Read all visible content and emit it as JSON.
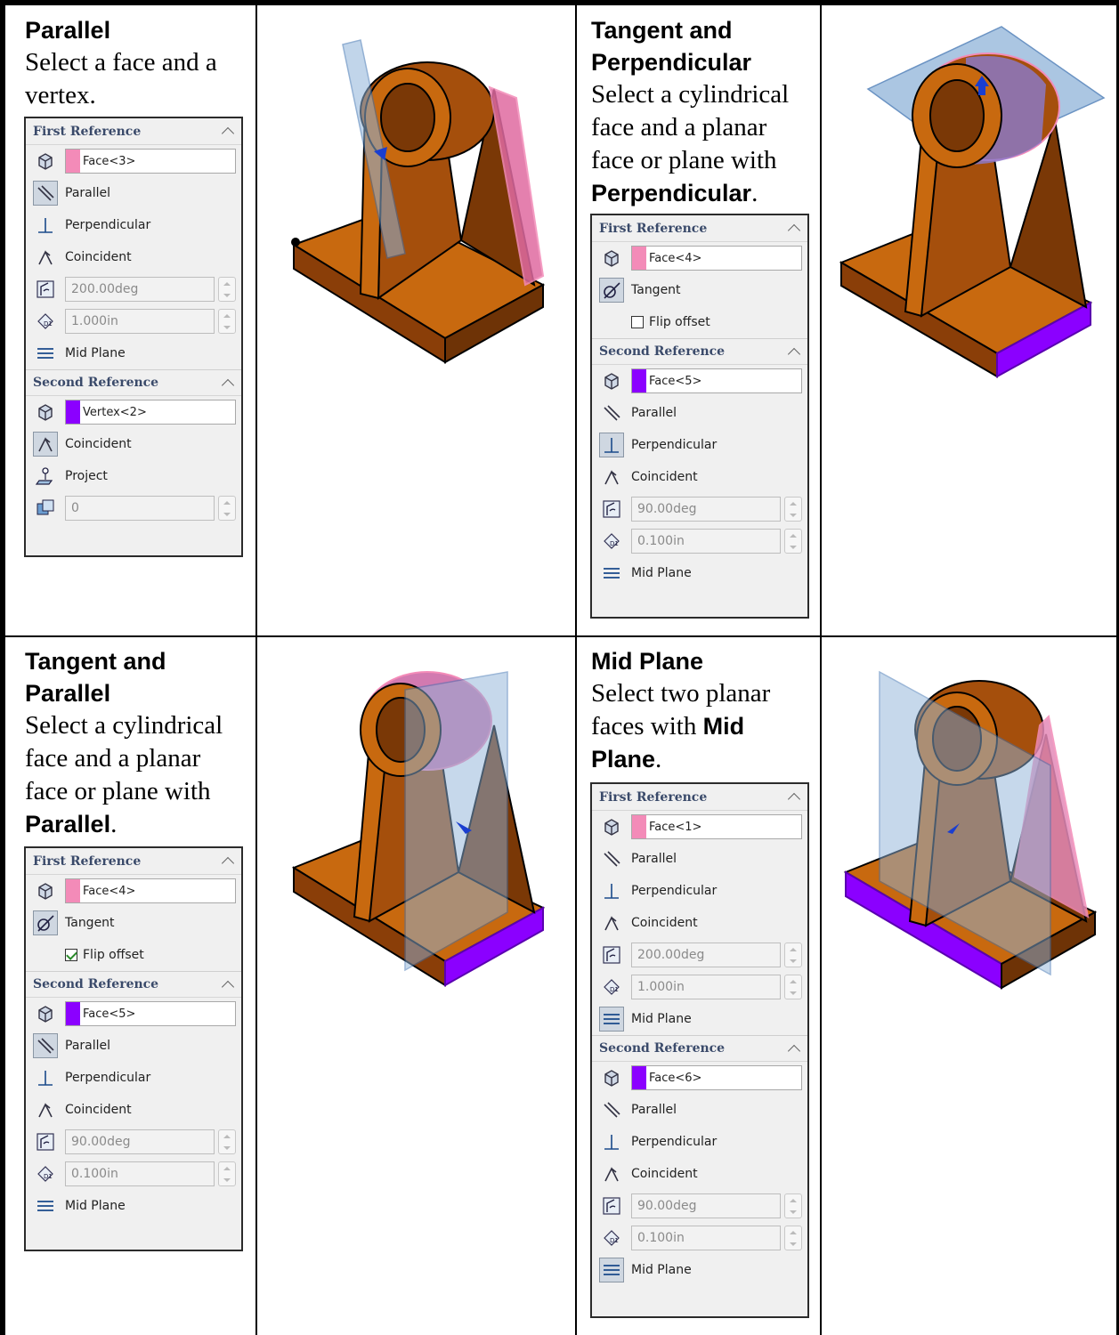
{
  "cells": {
    "parallel": {
      "title": "Parallel",
      "desc": "Select a face and a vertex.",
      "pm": {
        "first_ref_header": "First Reference",
        "first_ref_value": "Face<3>",
        "opt_parallel": "Parallel",
        "opt_perpendicular": "Perpendicular",
        "opt_coincident": "Coincident",
        "angle_value": "200.00deg",
        "distance_value": "1.000in",
        "opt_midplane": "Mid Plane",
        "second_ref_header": "Second Reference",
        "second_ref_value": "Vertex<2>",
        "second_coincident": "Coincident",
        "second_project": "Project",
        "second_count": "0"
      }
    },
    "tangent_perp": {
      "title_line1": "Tangent and",
      "title_line2": "Perpendicular",
      "desc_a": "Select a cylindrical face and a planar face or plane with ",
      "desc_bold": "Perpendicular",
      "desc_end": ".",
      "pm": {
        "first_ref_header": "First Reference",
        "first_ref_value": "Face<4>",
        "opt_tangent": "Tangent",
        "flip_offset": "Flip offset",
        "second_ref_header": "Second Reference",
        "second_ref_value": "Face<5>",
        "opt_parallel": "Parallel",
        "opt_perpendicular": "Perpendicular",
        "opt_coincident": "Coincident",
        "angle_value": "90.00deg",
        "distance_value": "0.100in",
        "opt_midplane": "Mid Plane"
      }
    },
    "tangent_par": {
      "title_line1": "Tangent and",
      "title_line2": "Parallel",
      "desc_a": "Select a cylindrical face and a planar face or plane with ",
      "desc_bold": "Parallel",
      "desc_end": ".",
      "pm": {
        "first_ref_header": "First Reference",
        "first_ref_value": "Face<4>",
        "opt_tangent": "Tangent",
        "flip_offset": "Flip offset",
        "second_ref_header": "Second Reference",
        "second_ref_value": "Face<5>",
        "opt_parallel": "Parallel",
        "opt_perpendicular": "Perpendicular",
        "opt_coincident": "Coincident",
        "angle_value": "90.00deg",
        "distance_value": "0.100in",
        "opt_midplane": "Mid Plane"
      }
    },
    "midplane": {
      "title": "Mid Plane",
      "desc_a": "Select two planar faces with ",
      "desc_bold": "Mid Plane",
      "desc_end": ".",
      "pm": {
        "first_ref_header": "First Reference",
        "first_ref_value": "Face<1>",
        "opt_parallel": "Parallel",
        "opt_perpendicular": "Perpendicular",
        "opt_coincident": "Coincident",
        "angle_value": "200.00deg",
        "distance_value": "1.000in",
        "opt_midplane": "Mid Plane",
        "second_ref_header": "Second Reference",
        "second_ref_value": "Face<6>",
        "second_parallel": "Parallel",
        "second_perpendicular": "Perpendicular",
        "second_coincident": "Coincident",
        "second_angle_value": "90.00deg",
        "second_distance_value": "0.100in",
        "second_midplane": "Mid Plane"
      }
    }
  },
  "colors": {
    "model_body": "#a54f0c",
    "model_light": "#c8690f",
    "model_dark": "#6e3306",
    "plane_fill": "#8fb3d9",
    "pink_select": "#f38bb8",
    "purple_select": "#8b00ff"
  }
}
